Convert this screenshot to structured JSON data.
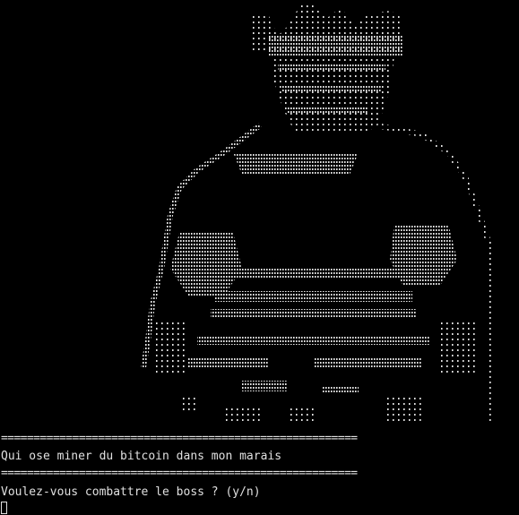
{
  "terminal": {
    "rule_top": "=======================================================",
    "message": "Qui ose miner du bitcoin dans mon marais",
    "rule_bottom": "=======================================================",
    "prompt": "Voulez-vous combattre le boss ? (y/n)"
  },
  "colors": {
    "background": "#000000",
    "text": "#e0e0e0"
  },
  "art": {
    "description_icon": "ascii-boss-art"
  }
}
